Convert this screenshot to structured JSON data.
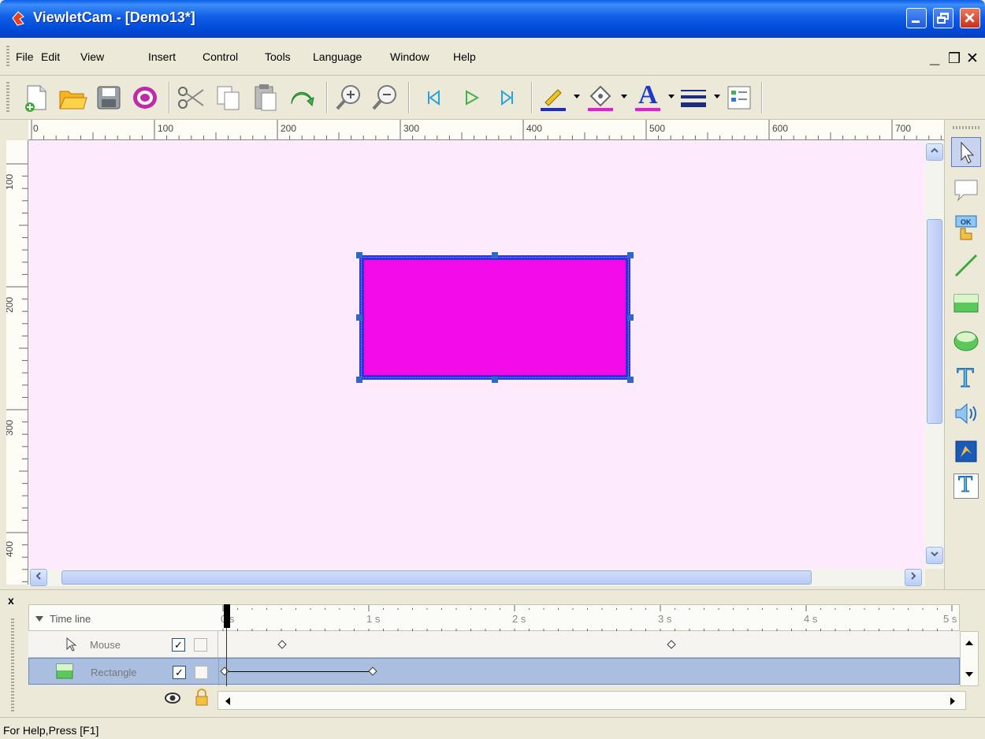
{
  "window": {
    "title": "ViewletCam - [Demo13*]"
  },
  "menu": {
    "items": [
      {
        "label": "File"
      },
      {
        "label": "Edit"
      },
      {
        "label": "View"
      },
      {
        "label": "Insert"
      },
      {
        "label": "Control"
      },
      {
        "label": "Tools"
      },
      {
        "label": "Language"
      },
      {
        "label": "Window"
      },
      {
        "label": "Help"
      }
    ],
    "mdi_minimize": "_",
    "mdi_restore": "❒",
    "mdi_close": "✕"
  },
  "toolbar": {
    "icons": [
      "new-icon",
      "open-icon",
      "save-icon",
      "record-icon",
      "cut-icon",
      "copy-icon",
      "paste-icon",
      "undo-icon",
      "zoom-in-icon",
      "zoom-out-icon",
      "first-frame-icon",
      "play-icon",
      "last-frame-icon",
      "line-color-icon",
      "fill-color-icon",
      "font-color-icon",
      "line-style-icon",
      "properties-icon"
    ],
    "font_color_glyph": "A"
  },
  "rulers": {
    "horizontal": [
      "0",
      "100",
      "200",
      "300",
      "400",
      "500",
      "600",
      "700"
    ],
    "vertical": [
      "100",
      "200",
      "300",
      "400"
    ]
  },
  "canvas": {
    "background": "#fdebfd",
    "shape": {
      "type": "Rectangle",
      "fill": "#f20ae8",
      "stroke": "#2b35d8"
    }
  },
  "palette": {
    "tools": [
      "pointer-icon",
      "callout-icon",
      "button-icon",
      "line-icon",
      "rectangle-icon",
      "ellipse-icon",
      "text-icon",
      "sound-icon",
      "image-icon",
      "text-input-icon"
    ],
    "text_glyph": "T"
  },
  "timeline": {
    "header": "Time line",
    "seconds": [
      "0 s",
      "1 s",
      "2 s",
      "3 s",
      "4 s",
      "5 s"
    ],
    "rows": [
      {
        "label": "Mouse",
        "visible_checked": "✓"
      },
      {
        "label": "Rectangle",
        "visible_checked": "✓"
      }
    ],
    "close_glyph": "x"
  },
  "status": {
    "text": "For Help,Press [F1]"
  },
  "colors": {
    "titlebar": "#0a5ee8",
    "chrome": "#ece9d8",
    "selection": "#aabedf"
  }
}
